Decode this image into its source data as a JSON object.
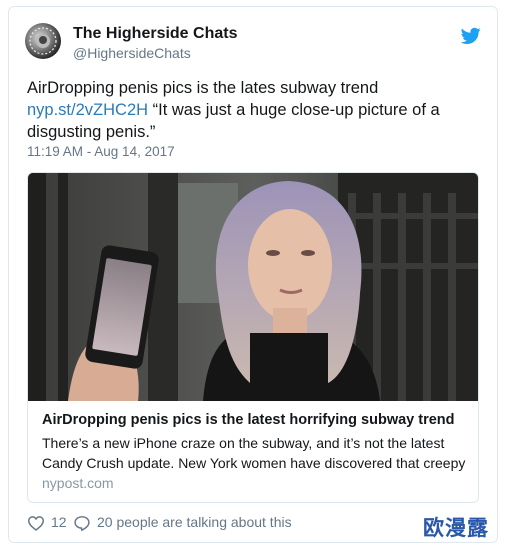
{
  "tweet": {
    "display_name": "The Higherside Chats",
    "handle": "@HighersideChats",
    "text_before_link": "AirDropping penis pics is the lates subway trend",
    "link_text": "nyp.st/2vZHC2H",
    "text_after_link": " “It was just a huge close-up picture of a disgusting penis.”",
    "timestamp": "11:19 AM - Aug 14, 2017"
  },
  "link_card": {
    "title": "AirDropping penis pics is the latest horrifying subway trend",
    "description": "There’s a new iPhone craze on the subway, and it’s not the latest Candy Crush update. New York women have discovered that creepy",
    "domain": "nypost.com"
  },
  "actions": {
    "like_count": "12",
    "talking_text": "20 people are talking about this"
  },
  "watermark": "欧漫露",
  "colors": {
    "link": "#2b7bb9",
    "twitter_blue": "#1da1f2",
    "muted": "#657786",
    "border": "#e1e8ed"
  },
  "icons": [
    "twitter-bird-icon",
    "heart-icon",
    "reply-icon"
  ]
}
